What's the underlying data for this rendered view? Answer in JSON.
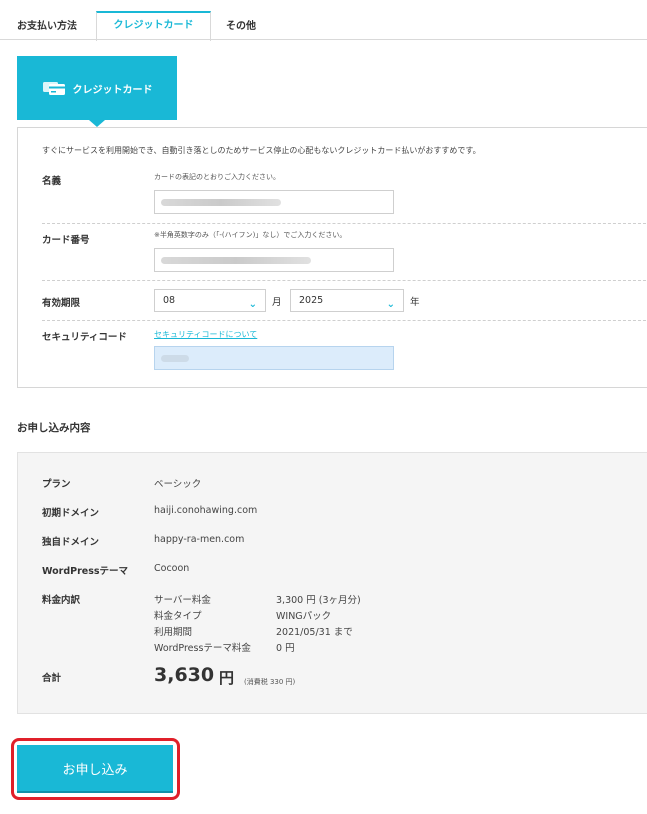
{
  "tabs": {
    "heading": "お支払い方法",
    "credit_card": "クレジットカード",
    "other": "その他"
  },
  "method": {
    "label": "クレジットカード",
    "icon": "credit-card-icon"
  },
  "form": {
    "intro": "すぐにサービスを利用開始でき、自動引き落としのためサービス停止の心配もないクレジットカード払いがおすすめです。",
    "name_label": "名義",
    "name_hint": "カードの表記のとおりご入力ください。",
    "number_label": "カード番号",
    "number_hint": "※半角英数字のみ（「-(ハイフン)」なし）でご入力ください。",
    "expiry_label": "有効期限",
    "month_value": "08",
    "month_unit": "月",
    "year_value": "2025",
    "year_unit": "年",
    "security_label": "セキュリティコード",
    "security_link": "セキュリティコードについて"
  },
  "order": {
    "title": "お申し込み内容",
    "plan_label": "プラン",
    "plan_value": "ベーシック",
    "initial_domain_label": "初期ドメイン",
    "initial_domain_value": "haiji.conohawing.com",
    "own_domain_label": "独自ドメイン",
    "own_domain_value": "happy-ra-men.com",
    "theme_label": "WordPressテーマ",
    "theme_value": "Cocoon",
    "fee_label": "料金内訳",
    "fees": [
      {
        "name": "サーバー料金",
        "value": "3,300 円 (3ヶ月分)"
      },
      {
        "name": "料金タイプ",
        "value": "WINGパック"
      },
      {
        "name": "利用期間",
        "value": "2021/05/31 まで"
      },
      {
        "name": "WordPressテーマ料金",
        "value": "0 円"
      }
    ],
    "total_label": "合計",
    "total_amount": "3,630",
    "total_unit": "円",
    "tax_note": "(消費税 330 円)"
  },
  "submit": {
    "label": "お申し込み"
  },
  "colors": {
    "accent": "#19b8d6",
    "highlight": "#e0202a"
  }
}
